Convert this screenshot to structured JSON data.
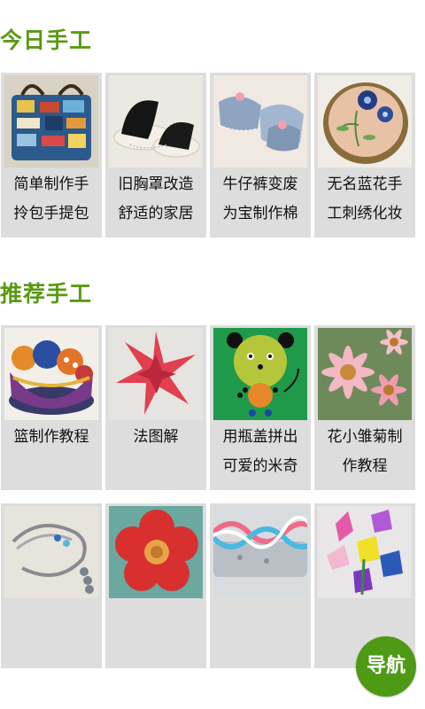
{
  "sections": {
    "today_title": "今日手工",
    "recommend_title": "推荐手工"
  },
  "today": [
    {
      "line1": "简单制作手",
      "line2": "拎包手提包",
      "image": "denim-bag-photo"
    },
    {
      "line1": "旧胸罩改造",
      "line2": "舒适的家居",
      "image": "slippers-photo"
    },
    {
      "line1": "牛仔裤变废",
      "line2": "为宝制作棉",
      "image": "denim-slippers-photo"
    },
    {
      "line1": "无名蓝花手",
      "line2": "工刺绣化妆",
      "image": "embroidery-photo"
    }
  ],
  "recommend": [
    {
      "line1": "篮制作教程",
      "line2": "",
      "image": "fabric-basket-photo"
    },
    {
      "line1": "法图解",
      "line2": "",
      "image": "origami-star-photo"
    },
    {
      "line1": "用瓶盖拼出",
      "line2": "可爱的米奇",
      "image": "bottlecap-bear-photo"
    },
    {
      "line1": "花小雏菊制",
      "line2": "作教程",
      "image": "paper-daisy-photo"
    },
    {
      "line1": "",
      "line2": "",
      "image": "bead-bracelet-photo"
    },
    {
      "line1": "",
      "line2": "",
      "image": "crochet-flower-photo"
    },
    {
      "line1": "",
      "line2": "",
      "image": "braided-bracelet-photo"
    },
    {
      "line1": "",
      "line2": "",
      "image": "paper-flowers-photo"
    }
  ],
  "nav": {
    "label": "导航"
  },
  "colors": {
    "accent": "#5a9a13",
    "card_bg": "#dddddd",
    "nav_bg": "#4e9a15"
  }
}
